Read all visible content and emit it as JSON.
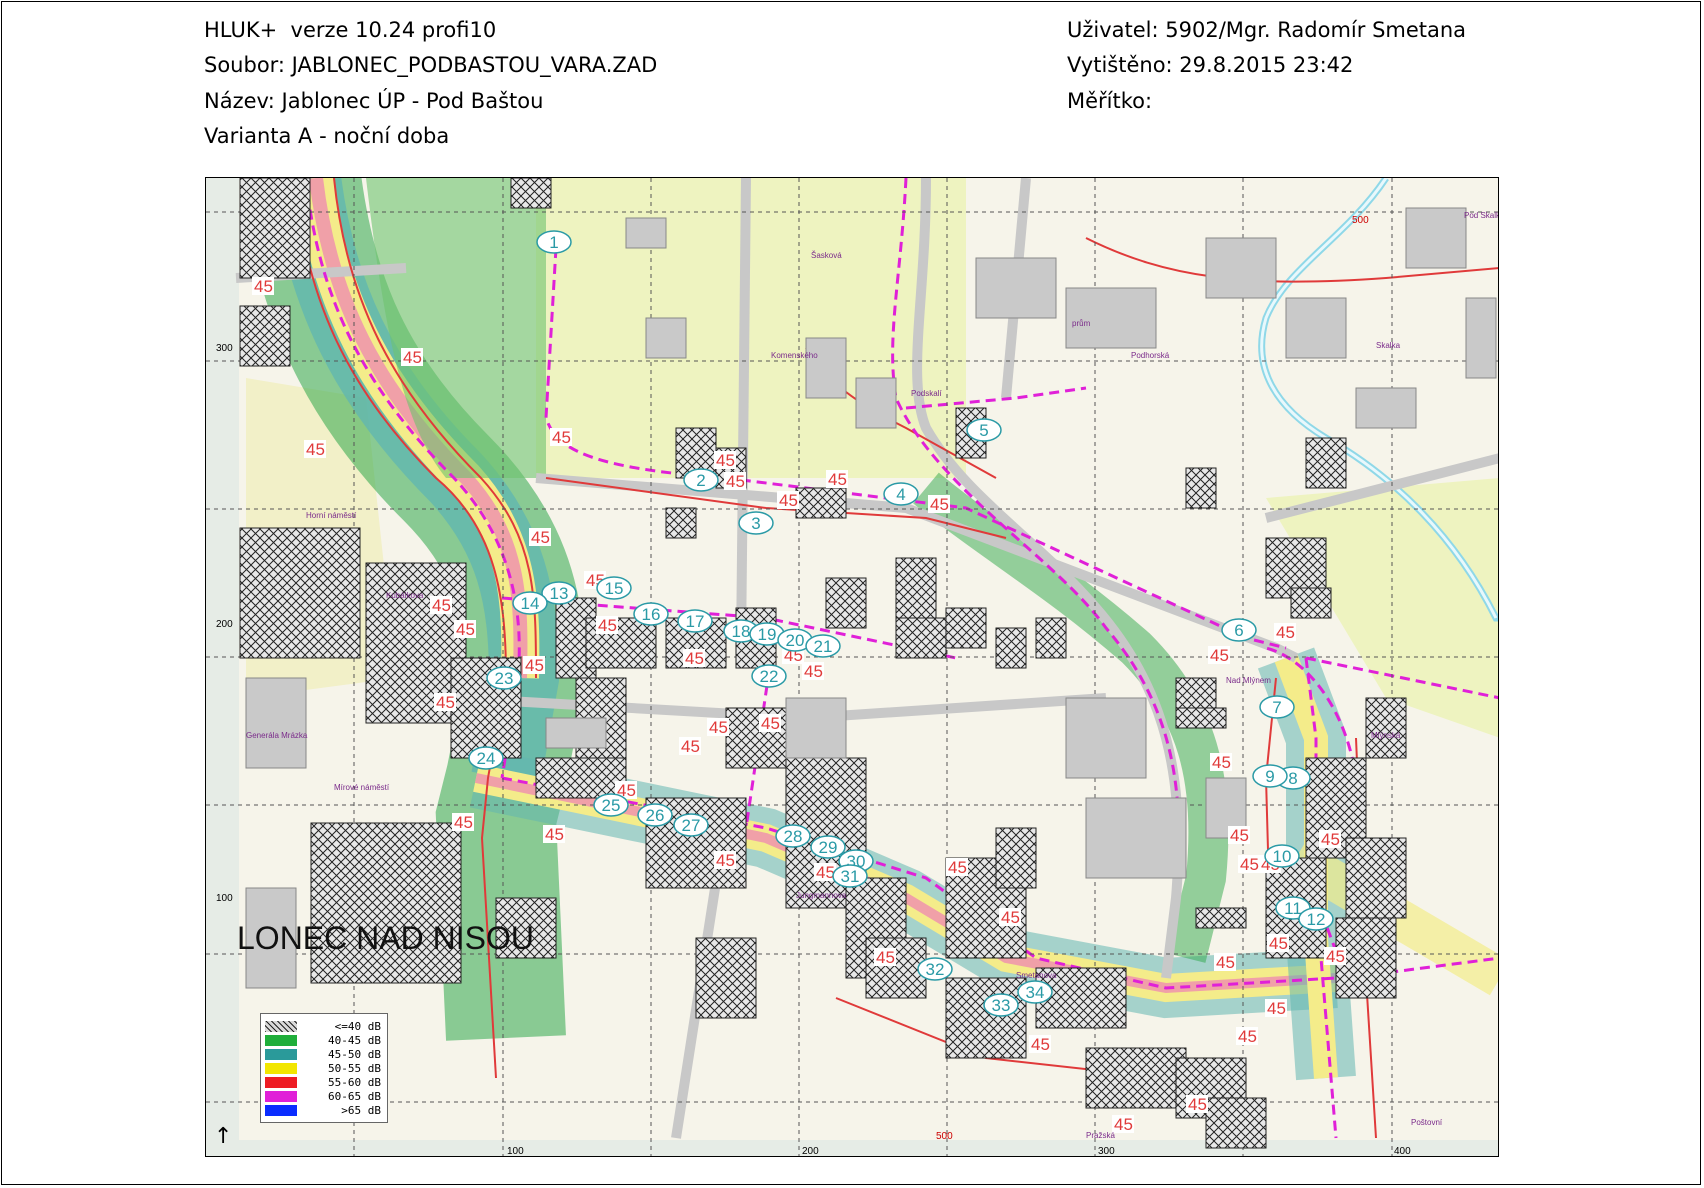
{
  "header": {
    "program": "HLUK+  verze 10.24 profi10",
    "file": "Soubor: JABLONEC_PODBASTOU_VARA.ZAD",
    "name": "Název: Jablonec ÚP - Pod Baštou",
    "variant": "Varianta A - noční doba",
    "user": "Uživatel: 5902/Mgr. Radomír Smetana",
    "printed": "Vytištěno: 29.8.2015 23:42",
    "scale": "Měřítko:"
  },
  "map": {
    "city_label": "LONEC NAD NISOU",
    "north_arrow": "↑",
    "axis_x_ticks": [
      "100",
      "200",
      "300",
      "400"
    ],
    "axis_y_ticks": [
      "300",
      "200",
      "100"
    ],
    "contour_label": "45",
    "extra_labels": [
      "500",
      "500"
    ],
    "street_labels": [
      "Horní náměstí",
      "Mírové náměstí",
      "Podskalí",
      "Skalka",
      "Pod Skalkou",
      "Nad Mlýnem",
      "Smetanova",
      "Šasková",
      "Pražská",
      "Jungmannova",
      "Komenského",
      "Kubálkova",
      "Generála Mrázka",
      "Podhorská",
      "Poštovní",
      "Mlýnská",
      "prům"
    ],
    "receptor_points": [
      "1",
      "2",
      "3",
      "4",
      "5",
      "6",
      "7",
      "8",
      "9",
      "10",
      "11",
      "12",
      "13",
      "14",
      "15",
      "16",
      "17",
      "18",
      "19",
      "20",
      "21",
      "22",
      "23",
      "24",
      "25",
      "26",
      "27",
      "28",
      "29",
      "30",
      "31",
      "32",
      "33",
      "34"
    ]
  },
  "legend": [
    {
      "label": "<=40 dB",
      "color": "#7f7f7f",
      "pattern": "hatch"
    },
    {
      "label": "40-45 dB",
      "color": "#1fae3a"
    },
    {
      "label": "45-50 dB",
      "color": "#2a9a9a"
    },
    {
      "label": "50-55 dB",
      "color": "#f2e600"
    },
    {
      "label": "55-60 dB",
      "color": "#ee1c24"
    },
    {
      "label": "60-65 dB",
      "color": "#e020d8"
    },
    {
      "label": ">65 dB",
      "color": "#0a2cff"
    }
  ],
  "colors": {
    "contour_line": "#e03a3a",
    "road_dashed": "#e020d8",
    "receptor_fill": "#ffffff",
    "receptor_stroke": "#2a9aa6",
    "receptor_text": "#2a9aa6",
    "building_hatch": "#222222",
    "green_zone": "#2fa84a",
    "teal_zone": "#62b6b0",
    "yellow_zone": "#f4ec8a",
    "river": "#8fd8e8"
  }
}
